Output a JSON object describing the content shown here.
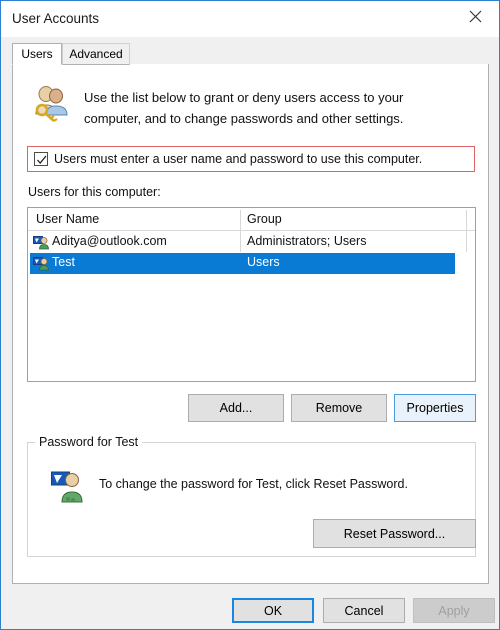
{
  "window": {
    "title": "User Accounts",
    "close_icon": "close-icon"
  },
  "tabs": [
    {
      "label": "Users",
      "active": true
    },
    {
      "label": "Advanced",
      "active": false
    }
  ],
  "intro": {
    "icon": "users-key-icon",
    "text": "Use the list below to grant or deny users access to your computer, and to change passwords and other settings."
  },
  "require_password": {
    "label": "Users must enter a user name and password to use this computer.",
    "checked": true,
    "highlight_color": "#e06464"
  },
  "user_list": {
    "caption": "Users for this computer:",
    "columns": [
      "User Name",
      "Group"
    ],
    "rows": [
      {
        "icon": "user-account-icon",
        "name": "Aditya@outlook.com",
        "group": "Administrators; Users",
        "selected": false
      },
      {
        "icon": "user-account-icon",
        "name": "Test",
        "group": "Users",
        "selected": true
      }
    ],
    "selection_color": "#0a7bd5"
  },
  "list_buttons": {
    "add": "Add...",
    "remove": "Remove",
    "properties": "Properties"
  },
  "password_group": {
    "legend": "Password for Test",
    "icon": "user-password-icon",
    "text": "To change the password for Test, click Reset Password.",
    "reset_button": "Reset Password..."
  },
  "footer": {
    "ok": "OK",
    "cancel": "Cancel",
    "apply": "Apply",
    "apply_disabled": true
  }
}
